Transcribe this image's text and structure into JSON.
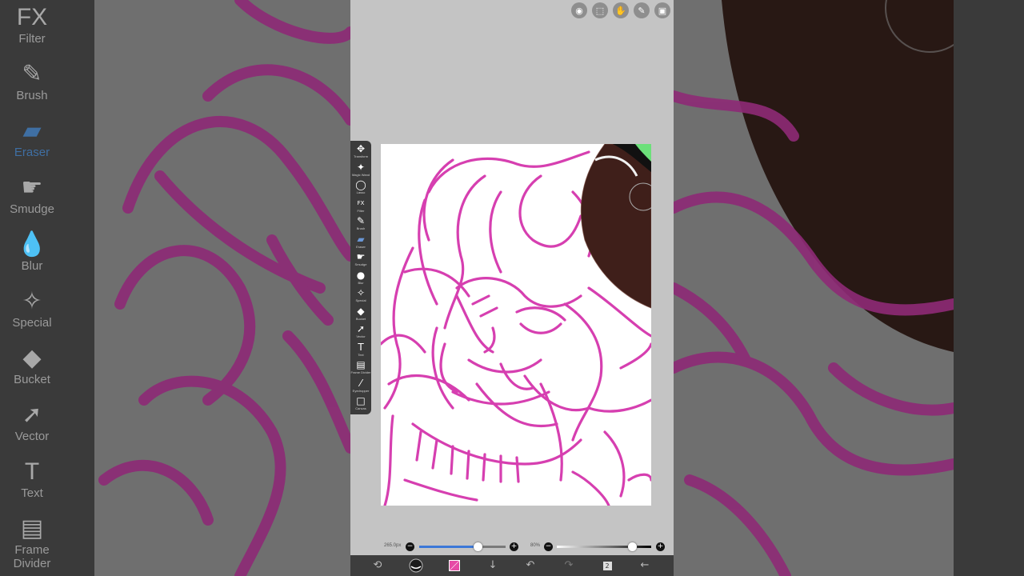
{
  "sidebar_ghost": {
    "tools": [
      {
        "icon": "FX",
        "label": "Filter"
      },
      {
        "icon": "✎",
        "label": "Brush"
      },
      {
        "icon": "▰",
        "label": "Eraser"
      },
      {
        "icon": "☛",
        "label": "Smudge"
      },
      {
        "icon": "💧",
        "label": "Blur"
      },
      {
        "icon": "✧",
        "label": "Special"
      },
      {
        "icon": "◆",
        "label": "Bucket"
      },
      {
        "icon": "➚",
        "label": "Vector"
      },
      {
        "icon": "T",
        "label": "Text"
      },
      {
        "icon": "▤",
        "label": "Frame Divider"
      }
    ],
    "active": "Eraser"
  },
  "top_icons": [
    {
      "name": "camera-icon",
      "glyph": "◉"
    },
    {
      "name": "selection-icon",
      "glyph": "⬚"
    },
    {
      "name": "hand-icon",
      "glyph": "✋"
    },
    {
      "name": "pencil-icon",
      "glyph": "✎"
    },
    {
      "name": "gallery-icon",
      "glyph": "▣"
    }
  ],
  "toolbar": {
    "tools": [
      {
        "icon": "✥",
        "label": "Transform"
      },
      {
        "icon": "✦",
        "label": "Magic Wand"
      },
      {
        "icon": "◯",
        "label": "Lasso"
      },
      {
        "icon": "FX",
        "label": "Filter"
      },
      {
        "icon": "✎",
        "label": "Brush"
      },
      {
        "icon": "▰",
        "label": "Eraser"
      },
      {
        "icon": "☛",
        "label": "Smudge"
      },
      {
        "icon": "●",
        "label": "Blur"
      },
      {
        "icon": "✧",
        "label": "Special"
      },
      {
        "icon": "◆",
        "label": "Bucket"
      },
      {
        "icon": "➚",
        "label": "Vector"
      },
      {
        "icon": "T",
        "label": "Text"
      },
      {
        "icon": "▤",
        "label": "Frame Divider"
      },
      {
        "icon": "⁄",
        "label": "Eyedropper"
      },
      {
        "icon": "□",
        "label": "Canvas"
      }
    ],
    "active": "Eraser"
  },
  "sliders": {
    "size_label": "265.0px",
    "size_fraction": 0.68,
    "opacity_label": "80%",
    "opacity_fraction": 0.8
  },
  "bottom_bar": {
    "brush_color": "#e64aa6",
    "icons": [
      "modify-icon",
      "brush-preview-icon",
      "color-swatch",
      "down-arrow-icon",
      "undo-icon",
      "redo-icon",
      "layers-icon",
      "back-icon"
    ],
    "layer_count": "2"
  },
  "colors": {
    "stroke": "#d63fb0",
    "brown": "#3f1f1a",
    "green": "#6ce07a",
    "accent": "#3b78d8"
  }
}
